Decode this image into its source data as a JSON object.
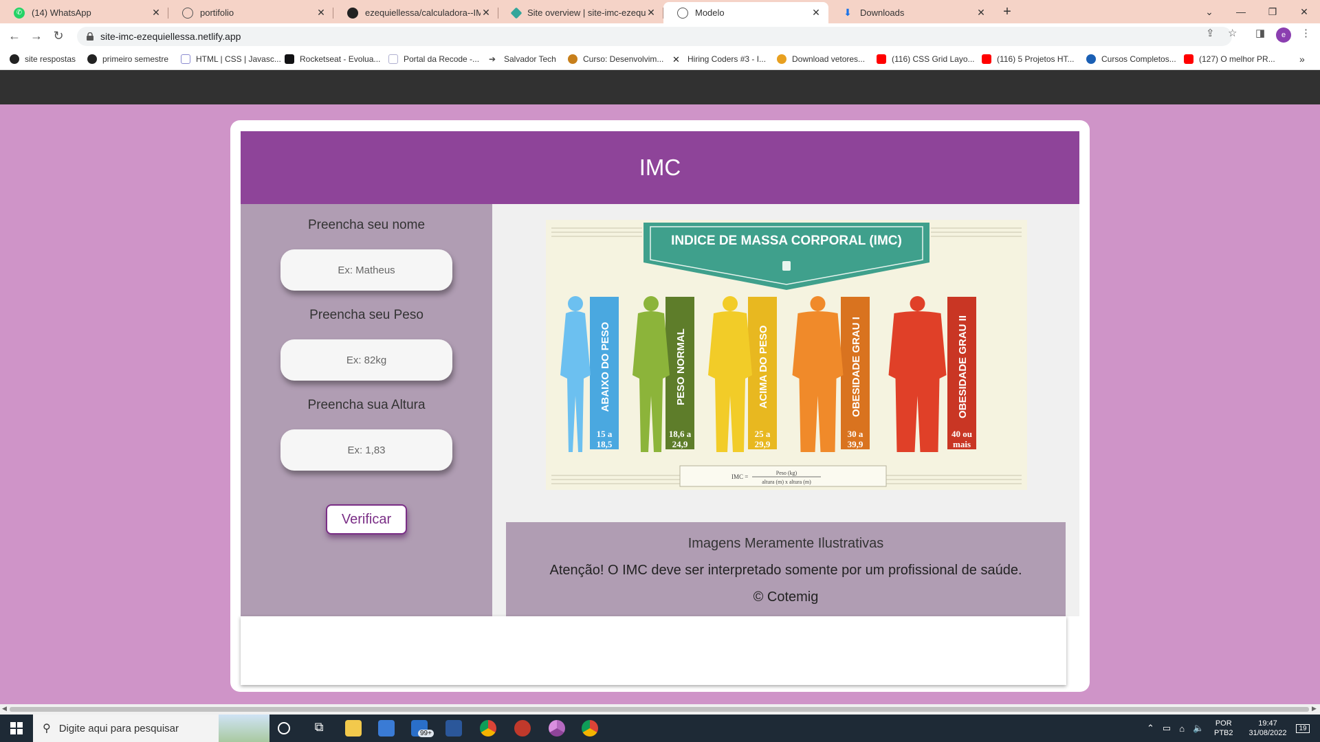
{
  "browser": {
    "tabs": [
      {
        "title": "(14) WhatsApp",
        "icon": "whatsapp-icon",
        "color": "#25d366"
      },
      {
        "title": "portifolio",
        "icon": "globe-icon",
        "color": "#555555"
      },
      {
        "title": "ezequiellessa/calculadora--IMC-",
        "icon": "github-icon",
        "color": "#222222"
      },
      {
        "title": "Site overview | site-imc-ezequiell",
        "icon": "netlify-icon",
        "color": "#33a69b"
      },
      {
        "title": "Modelo",
        "icon": "globe-icon",
        "color": "#555555"
      },
      {
        "title": "Downloads",
        "icon": "download-icon",
        "color": "#1a73e8"
      }
    ],
    "active_tab_index": 4,
    "url": "site-imc-ezequiellessa.netlify.app",
    "profile_initial": "e",
    "bookmarks": [
      {
        "label": "site respostas",
        "icon": "github-icon",
        "color": "#222222"
      },
      {
        "label": "primeiro semestre",
        "icon": "github-icon",
        "color": "#222222"
      },
      {
        "label": "HTML | CSS | Javasc...",
        "icon": "page-icon",
        "color": "#8a8ad0"
      },
      {
        "label": "Rocketseat - Evolua...",
        "icon": "rocketseat-icon",
        "color": "#121214"
      },
      {
        "label": "Portal da Recode -...",
        "icon": "page-icon",
        "color": "#b0b0d0"
      },
      {
        "label": "Salvador Tech",
        "icon": "arrow-icon",
        "color": "#444444"
      },
      {
        "label": "Curso: Desenvolvim...",
        "icon": "course-icon",
        "color": "#c77f1b"
      },
      {
        "label": "Hiring Coders #3 - I...",
        "icon": "vtex-icon",
        "color": "#222222"
      },
      {
        "label": "Download vetores...",
        "icon": "freepik-icon",
        "color": "#e8a020"
      },
      {
        "label": "(116) CSS Grid Layo...",
        "icon": "youtube-icon",
        "color": "#ff0000"
      },
      {
        "label": "(116) 5 Projetos HT...",
        "icon": "youtube-icon",
        "color": "#ff0000"
      },
      {
        "label": "Cursos Completos...",
        "icon": "course-icon",
        "color": "#1a5fb4"
      },
      {
        "label": "(127) O melhor PR...",
        "icon": "youtube-icon",
        "color": "#ff0000"
      }
    ]
  },
  "page": {
    "title": "IMC",
    "accent": "#8e4499",
    "form": {
      "name_label": "Preencha seu nome",
      "name_placeholder": "Ex: Matheus",
      "weight_label": "Preencha seu Peso",
      "weight_placeholder": "Ex: 82kg",
      "height_label": "Preencha sua Altura",
      "height_placeholder": "Ex: 1,83",
      "button": "Verificar"
    },
    "infographic": {
      "title": "INDICE DE MASSA CORPORAL (IMC)",
      "categories": [
        {
          "name": "ABAIXO DO PESO",
          "range_top": "15 a",
          "range_bottom": "18,5",
          "color": "#4aa8e0",
          "figure": "#6cc0f0"
        },
        {
          "name": "PESO NORMAL",
          "range_top": "18,6 a",
          "range_bottom": "24,9",
          "color": "#5e7d2a",
          "figure": "#8cb43a"
        },
        {
          "name": "ACIMA DO PESO",
          "range_top": "25 a",
          "range_bottom": "29,9",
          "color": "#e8b820",
          "figure": "#f2cc28"
        },
        {
          "name": "OBESIDADE GRAU I",
          "range_top": "30 a",
          "range_bottom": "39,9",
          "color": "#d9731f",
          "figure": "#f08a2a"
        },
        {
          "name": "OBESIDADE GRAU II",
          "range_top": "40 ou",
          "range_bottom": "mais",
          "color": "#c93624",
          "figure": "#e04028"
        }
      ],
      "formula_left": "IMC =",
      "formula_top": "Peso (kg)",
      "formula_bottom": "altura (m) x altura (m)"
    },
    "info": {
      "line1": "Imagens Meramente Ilustrativas",
      "line2": "Atenção! O IMC deve ser interpretado somente por um profissional de saúde.",
      "line3": "© Cotemig"
    }
  },
  "taskbar": {
    "search_placeholder": "Digite aqui para pesquisar",
    "mail_badge": "99+",
    "language": "POR",
    "layout": "PTB2",
    "time": "19:47",
    "date": "31/08/2022",
    "notifications": "19"
  }
}
